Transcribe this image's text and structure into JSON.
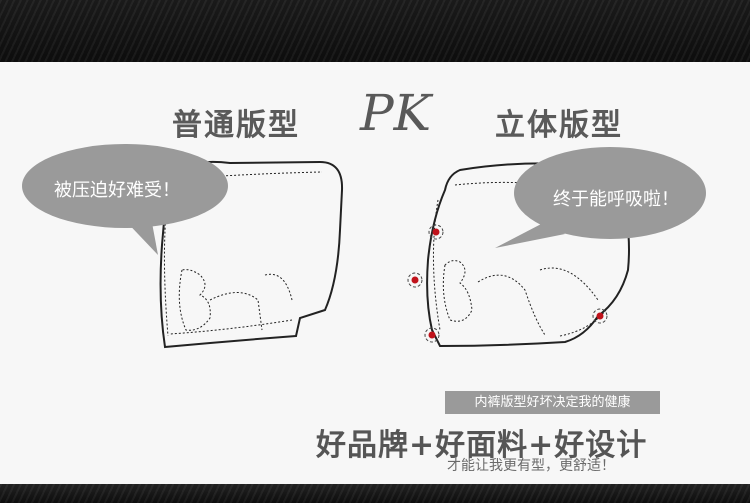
{
  "header": {
    "left_title": "普通版型",
    "vs_label": "PK",
    "right_title": "立体版型"
  },
  "bubbles": {
    "left_text": "被压迫好难受！",
    "right_text": "终于能呼吸啦！"
  },
  "slogan": {
    "tag": "内裤版型好坏决定我的健康",
    "main": "好品牌+好面料+好设计",
    "sub": "才能让我更有型，更舒适！"
  },
  "colors": {
    "background": "#f7f7f7",
    "fabric": "#111111",
    "bubble": "#9a9a9a",
    "title": "#5a5a5a",
    "pressure_dot": "#c0121b"
  }
}
